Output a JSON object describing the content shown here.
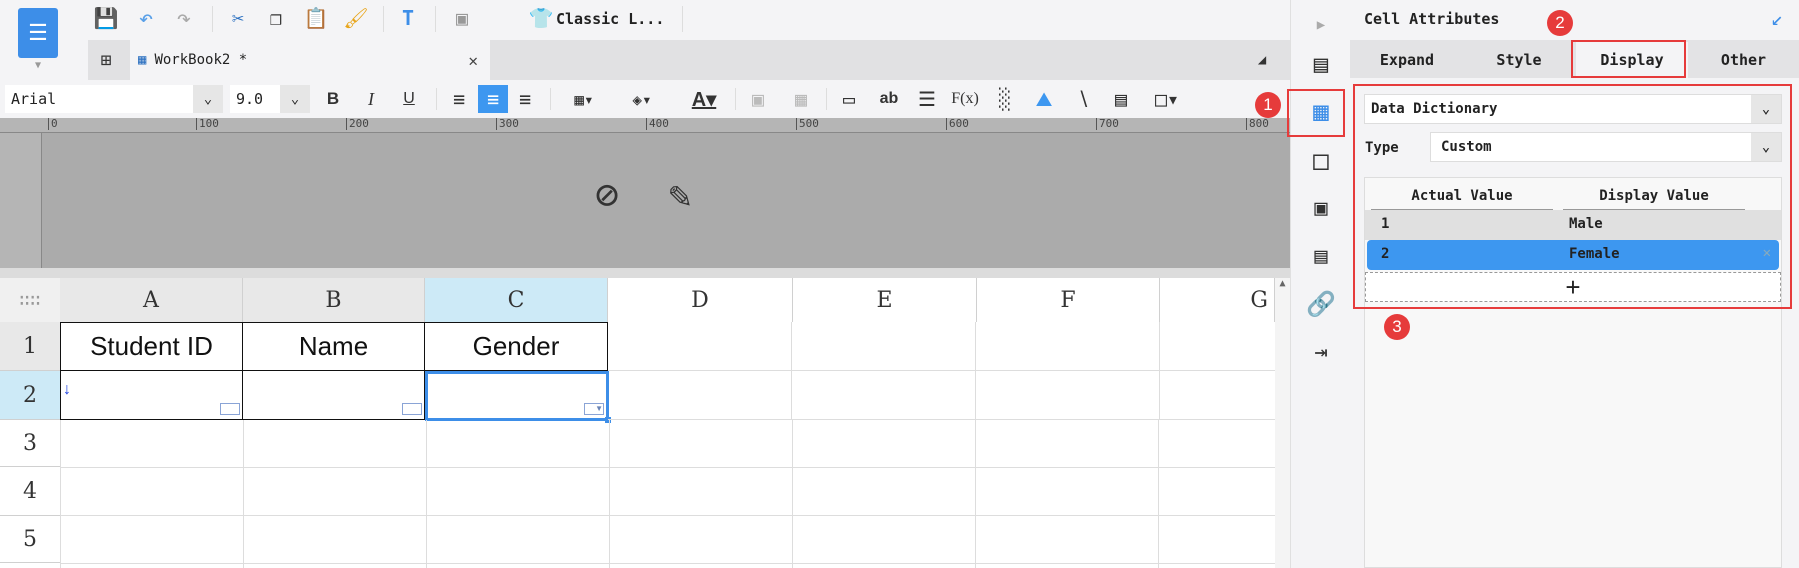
{
  "toolbar": {
    "theme_label": "Classic L...",
    "font": "Arial",
    "font_size": "9.0"
  },
  "tabs": [
    {
      "label": "WorkBook2 *"
    }
  ],
  "ruler": {
    "ticks": [
      "0",
      "100",
      "200",
      "300",
      "400",
      "500",
      "600",
      "700",
      "800"
    ]
  },
  "sheet": {
    "columns": [
      "A",
      "B",
      "C",
      "D",
      "E",
      "F",
      "G"
    ],
    "rows": [
      "1",
      "2",
      "3",
      "4",
      "5"
    ],
    "cells": {
      "A1": "Student ID",
      "B1": "Name",
      "C1": "Gender"
    },
    "selected_cell": "C2"
  },
  "panel": {
    "title": "Cell Attributes",
    "tabs": [
      "Expand",
      "Style",
      "Display",
      "Other"
    ],
    "active_tab": "Display",
    "display_mode": "Data Dictionary",
    "type_label": "Type",
    "type_value": "Custom",
    "table": {
      "headers": [
        "Actual Value",
        "Display Value"
      ],
      "rows": [
        {
          "actual": "1",
          "display": "Male"
        },
        {
          "actual": "2",
          "display": "Female"
        }
      ],
      "selected_row": 1
    },
    "add_label": "+"
  },
  "annotations": [
    "1",
    "2",
    "3"
  ],
  "colors": {
    "accent": "#3d97f0",
    "annotation": "#e63b3b"
  }
}
